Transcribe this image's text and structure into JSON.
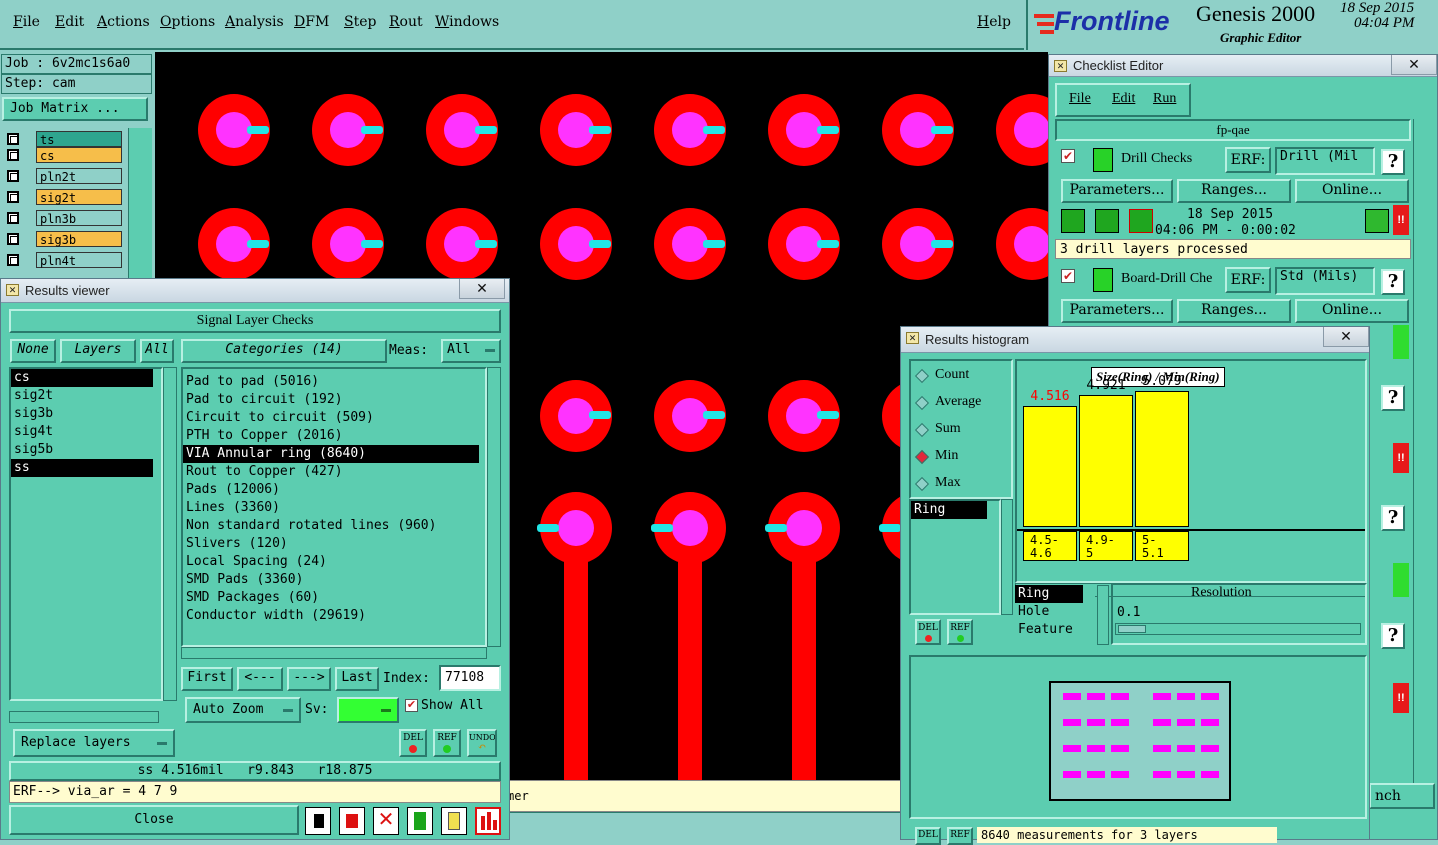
{
  "menu": {
    "file": "File",
    "edit": "Edit",
    "actions": "Actions",
    "options": "Options",
    "analysis": "Analysis",
    "dfm": "DFM",
    "step": "Step",
    "rout": "Rout",
    "windows": "Windows",
    "help": "Help"
  },
  "brand": {
    "logo": "Frontline",
    "product": "Genesis 2000",
    "subtitle": "Graphic Editor",
    "date": "18 Sep 2015",
    "time": "04:04 PM"
  },
  "job_panel": {
    "job": "Job : 6v2mc1s6a0",
    "step": "Step: cam",
    "job_matrix": "Job Matrix ..."
  },
  "layers": [
    {
      "name": "ts",
      "color": "#2ea58f"
    },
    {
      "name": "cs",
      "color": "#f6be4a"
    },
    {
      "name": "pln2t",
      "color": "#8fd0c8"
    },
    {
      "name": "sig2t",
      "color": "#f6be4a"
    },
    {
      "name": "pln3b",
      "color": "#8fd0c8"
    },
    {
      "name": "sig3b",
      "color": "#f6be4a"
    },
    {
      "name": "pln4t",
      "color": "#8fd0c8"
    }
  ],
  "canvas_status": "mer",
  "results_viewer": {
    "title": "Results viewer",
    "header": "Signal Layer Checks",
    "none_btn": "None",
    "layers_btn": "Layers",
    "all_btn": "All",
    "categories_btn": "Categories (14)",
    "meas_label": "Meas:",
    "meas_value": "All",
    "layer_list": [
      {
        "name": "cs",
        "selected": true
      },
      {
        "name": "sig2t",
        "selected": false
      },
      {
        "name": "sig3b",
        "selected": false
      },
      {
        "name": "sig4t",
        "selected": false
      },
      {
        "name": "sig5b",
        "selected": false
      },
      {
        "name": "ss",
        "selected": true
      }
    ],
    "categories": [
      {
        "label": "Pad to pad (5016)",
        "selected": false
      },
      {
        "label": "Pad to circuit (192)",
        "selected": false
      },
      {
        "label": "Circuit to circuit (509)",
        "selected": false
      },
      {
        "label": "PTH to Copper (2016)",
        "selected": false
      },
      {
        "label": "VIA Annular ring (8640)",
        "selected": true
      },
      {
        "label": "Rout to Copper (427)",
        "selected": false
      },
      {
        "label": "Pads (12006)",
        "selected": false
      },
      {
        "label": "Lines (3360)",
        "selected": false
      },
      {
        "label": "Non standard rotated lines (960)",
        "selected": false
      },
      {
        "label": "Slivers (120)",
        "selected": false
      },
      {
        "label": "Local Spacing (24)",
        "selected": false
      },
      {
        "label": "SMD Pads (3360)",
        "selected": false
      },
      {
        "label": "SMD Packages (60)",
        "selected": false
      },
      {
        "label": "Conductor width (29619)",
        "selected": false
      }
    ],
    "first": "First",
    "prev": "<---",
    "next": "--->",
    "last": "Last",
    "index_label": "Index:",
    "index_value": "77108",
    "auto_zoom": "Auto Zoom",
    "sv_label": "Sv:",
    "show_all": "Show All",
    "replace_layers": "Replace layers",
    "del": "DEL",
    "ref": "REF",
    "undo": "UNDO",
    "measure": "ss 4.516mil   r9.843   r18.875",
    "erf_line": "ERF--> via_ar = 4 7 9",
    "close": "Close"
  },
  "checklist": {
    "title": "Checklist Editor",
    "menu": {
      "file": "File",
      "edit": "Edit",
      "run": "Run"
    },
    "name": "fp-qae",
    "checks": [
      {
        "name": "Drill Checks",
        "erf_label": "ERF:",
        "erf_value": "Drill (Mil",
        "help": "?",
        "parameters": "Parameters...",
        "ranges": "Ranges...",
        "online": "Online...",
        "date": "18 Sep 2015",
        "time_range": "04:06 PM - 0:00:02",
        "status": "3 drill layers processed",
        "flag": "!!"
      },
      {
        "name": "Board-Drill Che",
        "erf_label": "ERF:",
        "erf_value": "Std (Mils)",
        "help": "?",
        "parameters": "Parameters...",
        "ranges": "Ranges...",
        "online": "Online..."
      }
    ],
    "side_marks": [
      "?",
      "!!",
      "?",
      "!!",
      "?"
    ],
    "launch_partial": "nch"
  },
  "histogram": {
    "title": "Results histogram",
    "modes": [
      {
        "label": "Count",
        "selected": false
      },
      {
        "label": "Average",
        "selected": false
      },
      {
        "label": "Sum",
        "selected": false
      },
      {
        "label": "Min",
        "selected": true
      },
      {
        "label": "Max",
        "selected": false
      }
    ],
    "list_item": "Ring",
    "chart_title": "Size(Ring) / Min(Ring)",
    "resolution_label": "Resolution",
    "resolution_value": "0.1",
    "feature_options": [
      {
        "label": "Ring",
        "selected": true
      },
      {
        "label": "Hole",
        "selected": false
      },
      {
        "label": "Feature",
        "selected": false
      }
    ],
    "del": "DEL",
    "ref": "REF",
    "footer_text": "8640 measurements for 3 layers"
  },
  "chart_data": {
    "type": "bar",
    "title": "Size(Ring) / Min(Ring)",
    "categories": [
      "4.5-4.6",
      "4.9-5",
      "5-5.1"
    ],
    "category_lines": [
      [
        "4.5-",
        "4.6"
      ],
      [
        "4.9-",
        "5"
      ],
      [
        "5-",
        "5.1"
      ]
    ],
    "values": [
      4.516,
      4.921,
      5.079
    ],
    "value_labels": [
      "4.516",
      "4.921",
      "5.079"
    ],
    "highlight_color": "#ff0000",
    "bar_color": "#ffff00",
    "ylim": [
      0,
      5.6
    ]
  },
  "colors": {
    "pad": "#ff0000",
    "hole": "#ff33ff",
    "annular_marker": "#22e6e6",
    "smd": "#ff00ff",
    "panel": "#5ccdb0",
    "canvas": "#000000"
  }
}
